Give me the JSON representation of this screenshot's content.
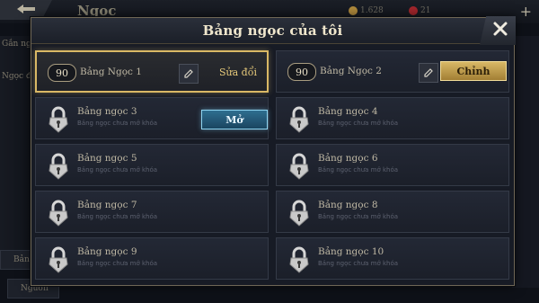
{
  "background": {
    "title": "Ngọc",
    "left_texts": [
      "Gắn ngọc",
      "Ngọc đ"
    ],
    "resource_1": "1.628",
    "resource_2": "21",
    "bottom_buttons": [
      "Bản",
      "Nguồn"
    ]
  },
  "dialog": {
    "title": "Bảng ngọc của tôi",
    "selected_page": {
      "level": "90",
      "name": "Bảng Ngọc 1",
      "edit_label": "Sửa đổi"
    },
    "second_page": {
      "level": "90",
      "name": "Bảng Ngọc 2",
      "button_label": "Chỉnh"
    },
    "open_button_label": "Mở",
    "locked_subtitle": "Bảng ngọc chưa mở khóa",
    "locked_pages": [
      {
        "name": "Bảng ngọc 3"
      },
      {
        "name": "Bảng ngọc 4"
      },
      {
        "name": "Bảng ngọc 5"
      },
      {
        "name": "Bảng ngọc 6"
      },
      {
        "name": "Bảng ngọc 7"
      },
      {
        "name": "Bảng ngọc 8"
      },
      {
        "name": "Bảng ngọc 9"
      },
      {
        "name": "Bảng ngọc 10"
      }
    ]
  },
  "colors": {
    "gold_accent": "#d9b865",
    "blue_button": "#2f6e8f",
    "panel_bg": "#171b25"
  },
  "icons": [
    "back-icon",
    "close-icon",
    "edit-icon",
    "lock-icon",
    "plus-icon"
  ]
}
